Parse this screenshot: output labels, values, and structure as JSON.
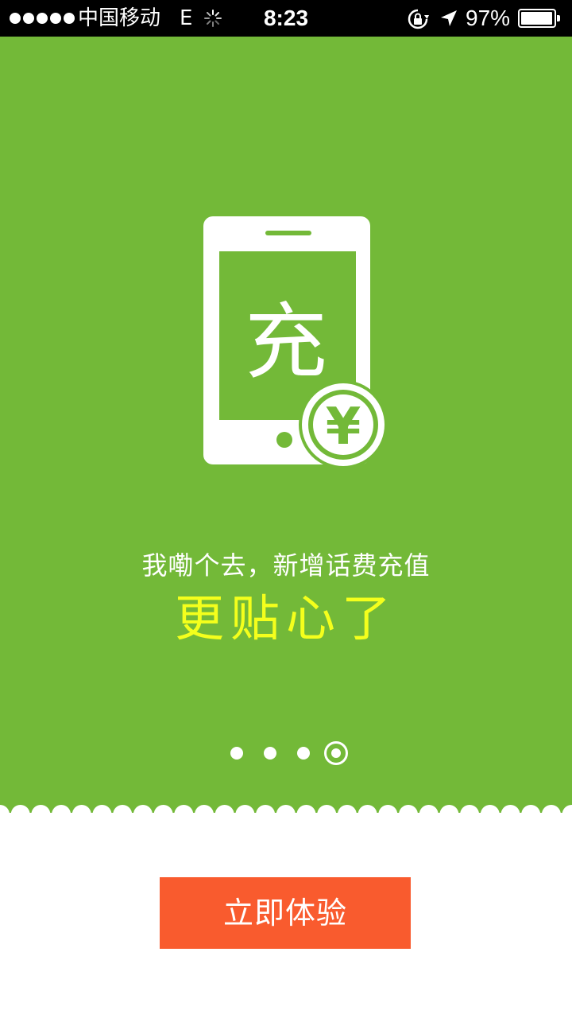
{
  "status_bar": {
    "carrier": "中国移动",
    "network": "E",
    "time": "8:23",
    "battery_percent": "97%",
    "battery_level": 0.97,
    "icons": [
      "signal-dots-icon",
      "activity-spinner-icon",
      "rotation-lock-icon",
      "location-arrow-icon",
      "battery-icon"
    ]
  },
  "hero": {
    "phone_glyph": "充",
    "coin_glyph": "¥",
    "icon": "phone-recharge-icon"
  },
  "promo": {
    "tagline": "我嘞个去，新增话费充值",
    "headline": "更贴心了"
  },
  "pager": {
    "count": 4,
    "active_index": 3
  },
  "cta": {
    "label": "立即体验"
  },
  "colors": {
    "banner": "#73b938",
    "headline": "#f4ff1c",
    "cta": "#f95b2e",
    "status_bar": "#000000"
  }
}
